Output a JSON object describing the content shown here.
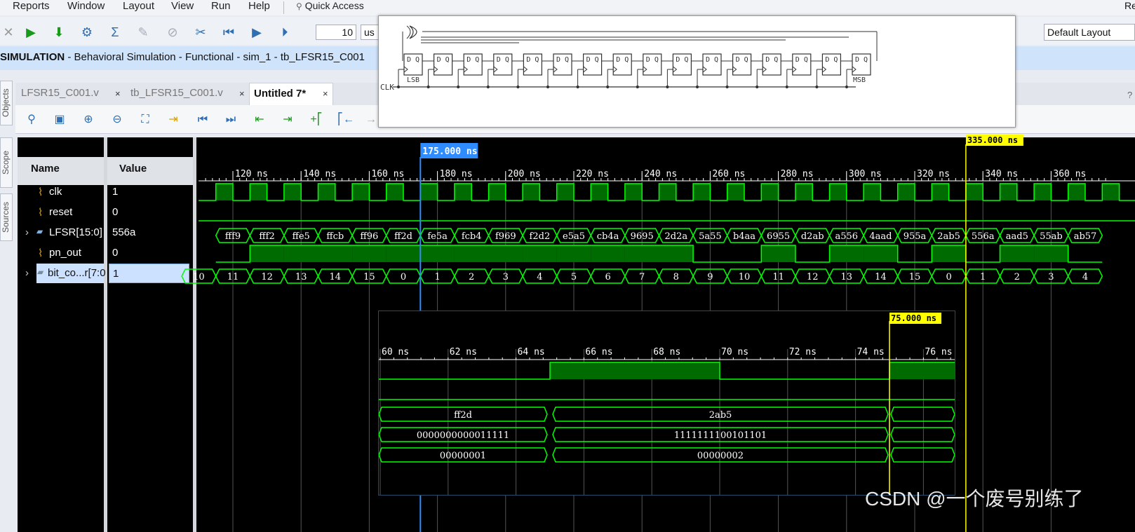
{
  "menu": [
    "Reports",
    "Window",
    "Layout",
    "View",
    "Run",
    "Help"
  ],
  "quick_access": "Quick Access",
  "corner_mark": "Re",
  "toolbar": {
    "time_value": "10",
    "time_unit": "us",
    "layout": "Default Layout"
  },
  "banner": {
    "bold": "SIMULATION",
    "rest": " - Behavioral Simulation - Functional - sim_1 - tb_LFSR15_C001"
  },
  "side_tabs": [
    "Objects",
    "Scope",
    "Sources"
  ],
  "tabs": [
    {
      "label": "LFSR15_C001.v"
    },
    {
      "label": "tb_LFSR15_C001.v"
    },
    {
      "label": "Untitled 7*"
    }
  ],
  "close_glyph": "×",
  "wave": {
    "name_header": "Name",
    "value_header": "Value",
    "signals": [
      {
        "name": "clk",
        "value": "1"
      },
      {
        "name": "reset",
        "value": "0"
      },
      {
        "name": "LFSR[15:0]",
        "value": "556a"
      },
      {
        "name": "pn_out",
        "value": "0"
      },
      {
        "name": "bit_co...r[7:0",
        "value": "1"
      }
    ],
    "cursor_label": "175.000 ns",
    "marker_label": "335.000 ns",
    "time_ticks": [
      "120 ns",
      "140 ns",
      "160 ns",
      "180 ns",
      "200 ns",
      "220 ns",
      "240 ns",
      "260 ns",
      "280 ns",
      "300 ns",
      "320 ns",
      "340 ns",
      "360 ns"
    ],
    "lfsr_values": [
      "fff9",
      "fff2",
      "ffe5",
      "ffcb",
      "ff96",
      "ff2d",
      "fe5a",
      "fcb4",
      "f969",
      "f2d2",
      "e5a5",
      "cb4a",
      "9695",
      "2d2a",
      "5a55",
      "b4aa",
      "6955",
      "d2ab",
      "a556",
      "4aad",
      "955a",
      "2ab5",
      "556a",
      "aad5",
      "55ab",
      "ab57"
    ],
    "counter_values": [
      "10",
      "11",
      "12",
      "13",
      "14",
      "15",
      "0",
      "1",
      "2",
      "3",
      "4",
      "5",
      "6",
      "7",
      "8",
      "9",
      "10",
      "11",
      "12",
      "13",
      "14",
      "15",
      "0",
      "1",
      "2",
      "3",
      "4"
    ],
    "pn_out_bits": [
      0,
      1,
      1,
      1,
      1,
      1,
      1,
      1,
      1,
      1,
      1,
      1,
      1,
      1,
      0,
      0,
      1,
      0,
      1,
      1,
      0,
      1,
      0,
      1,
      1,
      0
    ]
  },
  "schematic": {
    "clk_label": "CLK",
    "lsb_label": "LSB",
    "msb_label": "MSB",
    "ff_text": "D Q"
  },
  "zoom": {
    "marker_label": "75.000 ns",
    "time_ticks": [
      "60 ns",
      "62 ns",
      "64 ns",
      "66 ns",
      "68 ns",
      "70 ns",
      "72 ns",
      "74 ns",
      "76 ns"
    ],
    "lfsr": [
      "ff2d",
      "2ab5"
    ],
    "lfsr_bin": [
      "0000000000011111",
      "1111111100101101"
    ],
    "counter_bin": [
      "00000001",
      "00000002"
    ]
  },
  "watermark": "CSDN @一个废号别练了",
  "colors": {
    "wave_green": "#00ff00",
    "fill_green": "#006b00",
    "cursor_blue": "#2f8cff",
    "marker_yellow": "#ffff00"
  }
}
